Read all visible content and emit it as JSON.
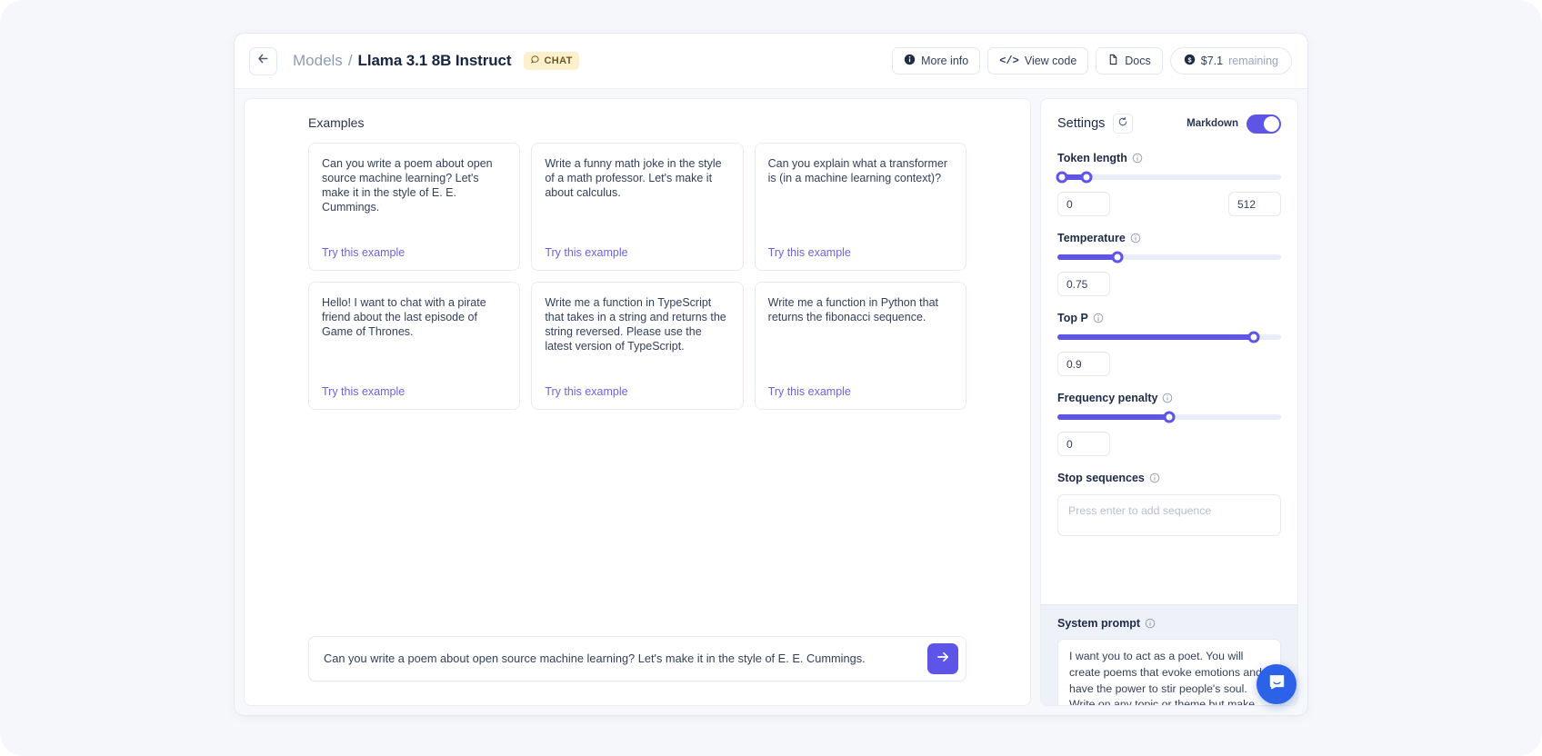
{
  "header": {
    "back_icon": "arrow-left-icon",
    "breadcrumb_parent": "Models",
    "breadcrumb_separator": "/",
    "breadcrumb_title": "Llama 3.1 8B Instruct",
    "badge": {
      "icon": "chat-bubble-icon",
      "label": "CHAT",
      "bg": "#fdf0cd",
      "fg": "#6b5a22"
    },
    "actions": [
      {
        "icon": "info-circle-icon",
        "label": "More info"
      },
      {
        "icon": "code-brackets-icon",
        "label": "View code"
      },
      {
        "icon": "document-icon",
        "label": "Docs"
      }
    ],
    "balance": {
      "icon": "dollar-coin-icon",
      "amount": "$7.1",
      "suffix": "remaining"
    }
  },
  "main": {
    "examples_title": "Examples",
    "try_label": "Try this example",
    "examples": [
      {
        "text": "Can you write a poem about open source machine learning? Let's make it in the style of E. E. Cummings."
      },
      {
        "text": "Write a funny math joke in the style of a math professor. Let's make it about calculus."
      },
      {
        "text": "Can you explain what a transformer is (in a machine learning context)?"
      },
      {
        "text": "Hello! I want to chat with a pirate friend about the last episode of Game of Thrones."
      },
      {
        "text": "Write me a function in TypeScript that takes in a string and returns the string reversed. Please use the latest version of TypeScript."
      },
      {
        "text": "Write me a function in Python that returns the fibonacci sequence."
      }
    ],
    "composer": {
      "value": "Can you write a poem about open source machine learning? Let's make it in the style of E. E. Cummings.",
      "send_icon": "arrow-right-icon"
    }
  },
  "settings": {
    "title": "Settings",
    "reset_icon": "refresh-icon",
    "markdown_label": "Markdown",
    "markdown_on": true,
    "accent": "#5e55e6",
    "token_length": {
      "label": "Token length",
      "info_icon": "info-icon",
      "min_value": "0",
      "max_value": "512",
      "handle_low_pct": 2,
      "handle_high_pct": 13
    },
    "temperature": {
      "label": "Temperature",
      "info_icon": "info-icon",
      "value": "0.75",
      "fill_pct": 27
    },
    "top_p": {
      "label": "Top P",
      "info_icon": "info-icon",
      "value": "0.9",
      "fill_pct": 88
    },
    "frequency_penalty": {
      "label": "Frequency penalty",
      "info_icon": "info-icon",
      "value": "0",
      "fill_pct": 50
    },
    "stop_sequences": {
      "label": "Stop sequences",
      "info_icon": "info-icon",
      "placeholder": "Press enter to add sequence"
    },
    "system_prompt": {
      "label": "System prompt",
      "info_icon": "info-icon",
      "value": "I want you to act as a poet. You will create poems that evoke emotions and have the power to stir people's soul. Write on any topic or theme but make sure your words"
    }
  },
  "support": {
    "icon": "intercom-chat-icon",
    "color": "#2b62e8"
  }
}
